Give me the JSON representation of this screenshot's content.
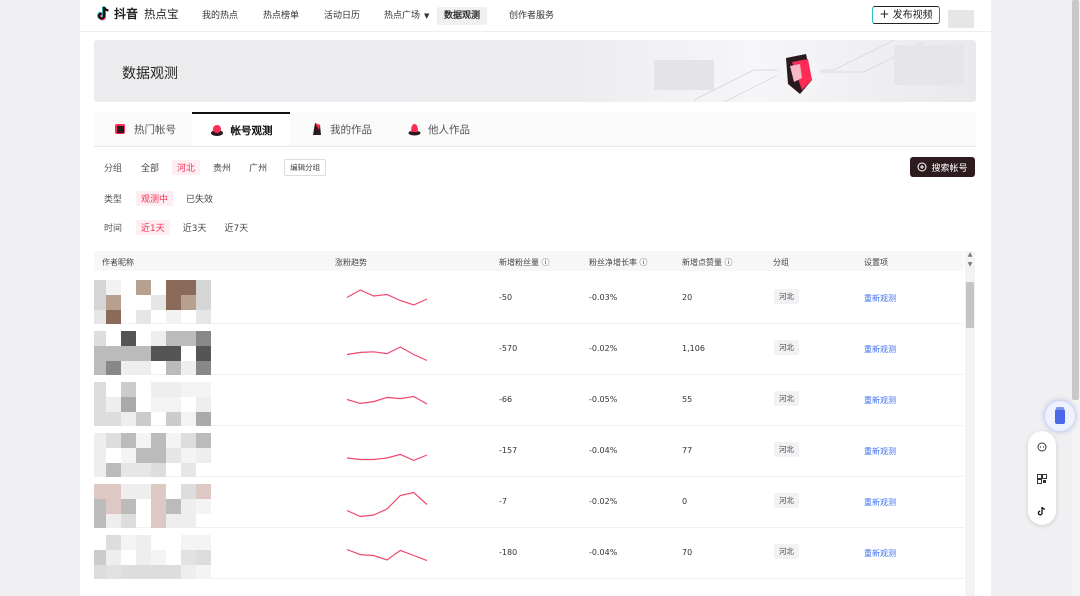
{
  "app": {
    "brand": "抖音",
    "product": "热点宝"
  },
  "nav": {
    "items": [
      "我的热点",
      "热点榜单",
      "活动日历",
      "热点广场",
      "数据观测",
      "创作者服务"
    ],
    "active_index": 4,
    "publish_label": "发布视频"
  },
  "banner": {
    "title": "数据观测"
  },
  "tabs": {
    "items": [
      "热门帐号",
      "帐号观测",
      "我的作品",
      "他人作品"
    ],
    "active_index": 1
  },
  "filters": {
    "group": {
      "label": "分组",
      "options": [
        "全部",
        "河北",
        "贵州",
        "广州"
      ],
      "selected": "河北",
      "edit_label": "编辑分组"
    },
    "type": {
      "label": "类型",
      "options": [
        "观测中",
        "已失效"
      ],
      "selected": "观测中"
    },
    "time": {
      "label": "时间",
      "options": [
        "近1天",
        "近3天",
        "近7天"
      ],
      "selected": "近1天"
    },
    "search_label": "搜索帐号"
  },
  "table": {
    "columns": [
      "作者昵称",
      "涨粉趋势",
      "新增粉丝量",
      "粉丝净增长率",
      "新增点赞量",
      "分组",
      "设置项"
    ],
    "rows": [
      {
        "new_fans": "-50",
        "growth": "-0.03%",
        "new_likes": "20",
        "group": "河北",
        "action": "重新观测",
        "trend": [
          0.55,
          0.8,
          0.6,
          0.65,
          0.45,
          0.3,
          0.5
        ]
      },
      {
        "new_fans": "-570",
        "growth": "-0.02%",
        "new_likes": "1,106",
        "group": "河北",
        "action": "重新观测",
        "trend": [
          0.35,
          0.42,
          0.44,
          0.38,
          0.6,
          0.35,
          0.15
        ]
      },
      {
        "new_fans": "-66",
        "growth": "-0.05%",
        "new_likes": "55",
        "group": "河北",
        "action": "重新观测",
        "trend": [
          0.55,
          0.42,
          0.48,
          0.62,
          0.58,
          0.65,
          0.4
        ]
      },
      {
        "new_fans": "-157",
        "growth": "-0.04%",
        "new_likes": "77",
        "group": "河北",
        "action": "重新观测",
        "trend": [
          0.3,
          0.25,
          0.25,
          0.3,
          0.42,
          0.22,
          0.4
        ]
      },
      {
        "new_fans": "-7",
        "growth": "-0.02%",
        "new_likes": "0",
        "group": "河北",
        "action": "重新观测",
        "trend": [
          0.25,
          0.05,
          0.1,
          0.3,
          0.75,
          0.85,
          0.45
        ]
      },
      {
        "new_fans": "-180",
        "growth": "-0.04%",
        "new_likes": "70",
        "group": "河北",
        "action": "重新观测",
        "trend": [
          0.65,
          0.48,
          0.45,
          0.3,
          0.62,
          0.45,
          0.28
        ]
      }
    ]
  },
  "colors": {
    "accent": "#fe2c55",
    "link": "#3a6df0",
    "trend_line": "#f0476c"
  },
  "icons": {
    "logo": "douyin-logo-icon",
    "plus": "plus-icon",
    "search": "plus-circle-icon"
  }
}
